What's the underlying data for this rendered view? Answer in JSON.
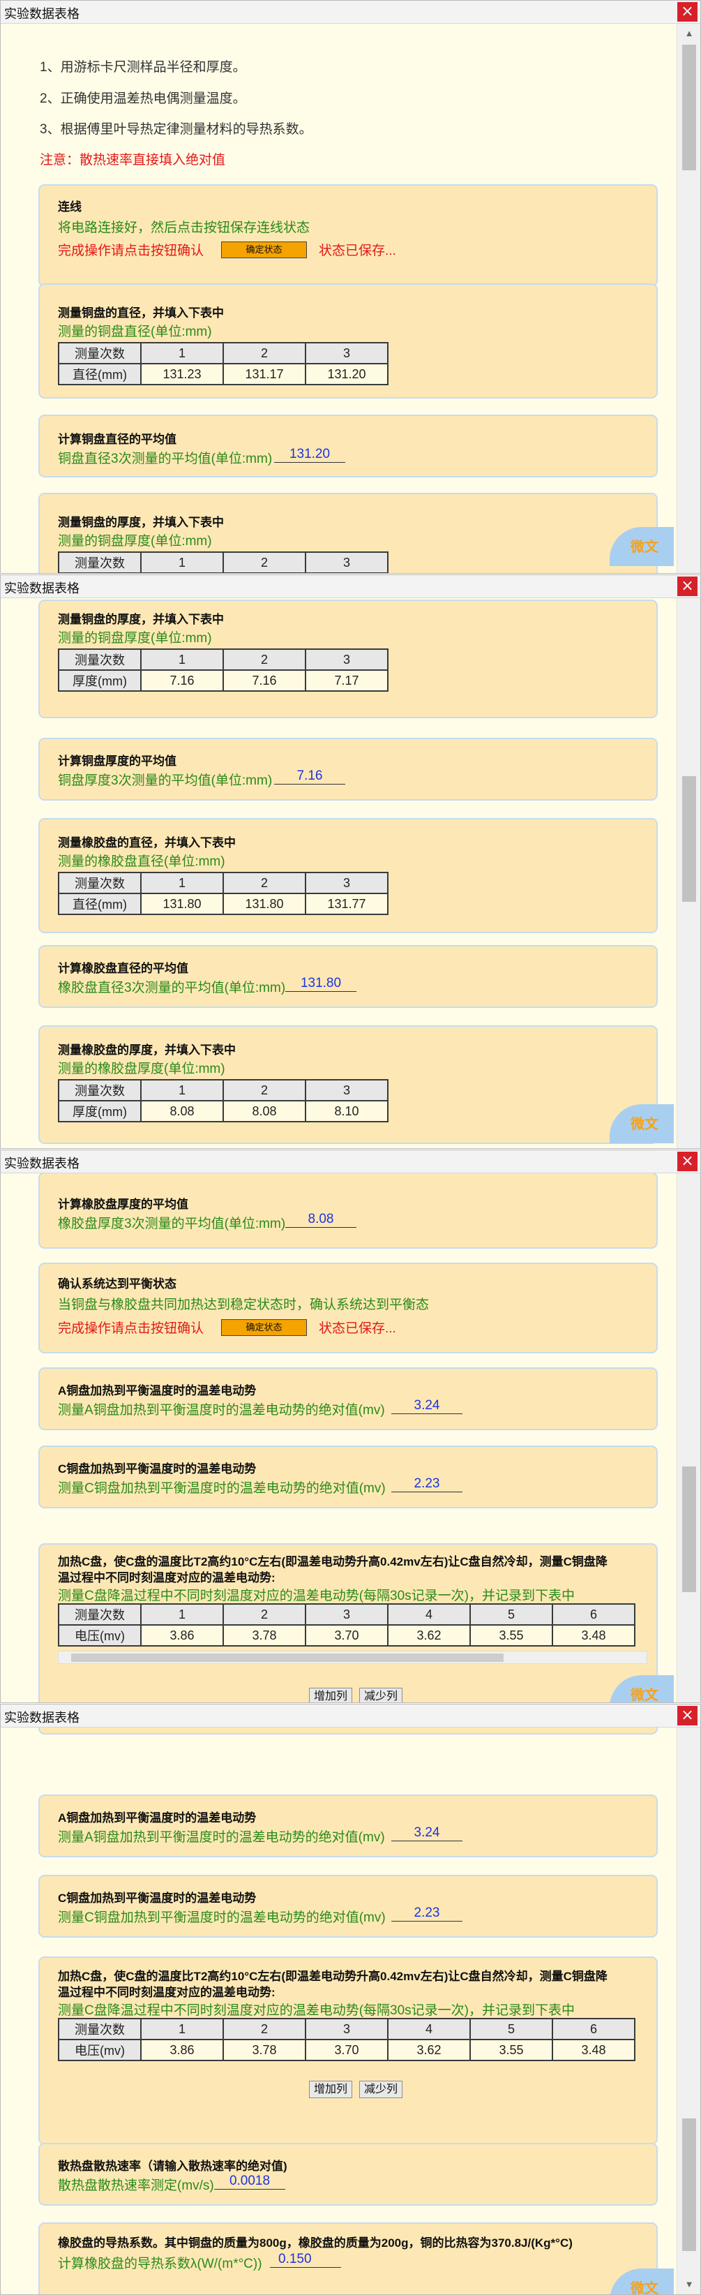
{
  "window_title": "实验数据表格",
  "close_glyph": "×",
  "instructions": [
    "1、用游标卡尺测样品半径和厚度。",
    "2、正确使用温差热电偶测量温度。",
    "3、根据傅里叶导热定律测量材料的导热系数。"
  ],
  "note": "注意：散热速率直接填入绝对值",
  "confirm_button": "确定状态",
  "saved_text": "状态已保存...",
  "chat_label": "微文",
  "add_col": "增加列",
  "del_col": "减少列",
  "connect": {
    "title": "连线",
    "line1": "将电路连接好，然后点击按钮保存连线状态",
    "prompt": "完成操作请点击按钮确认"
  },
  "count_label": "测量次数",
  "cols": [
    "1",
    "2",
    "3",
    "4",
    "5",
    "6"
  ],
  "cu_dia": {
    "title": "测量铜盘的直径，并填入下表中",
    "subtitle": "测量的铜盘直径(单位:mm)",
    "row_label": "直径(mm)",
    "values": [
      "131.23",
      "131.17",
      "131.20"
    ]
  },
  "cu_dia_avg": {
    "title": "计算铜盘直径的平均值",
    "label": "铜盘直径3次测量的平均值(单位:mm)",
    "value": "131.20"
  },
  "cu_thk": {
    "title": "测量铜盘的厚度，并填入下表中",
    "subtitle": "测量的铜盘厚度(单位:mm)",
    "row_label": "厚度(mm)",
    "values": [
      "7.16",
      "7.16",
      "7.17"
    ]
  },
  "cu_thk_avg": {
    "title": "计算铜盘厚度的平均值",
    "label": "铜盘厚度3次测量的平均值(单位:mm)",
    "value": "7.16"
  },
  "rb_dia": {
    "title": "测量橡胶盘的直径，并填入下表中",
    "subtitle": "测量的橡胶盘直径(单位:mm)",
    "row_label": "直径(mm)",
    "values": [
      "131.80",
      "131.80",
      "131.77"
    ]
  },
  "rb_dia_avg": {
    "title": "计算橡胶盘直径的平均值",
    "label": "橡胶盘直径3次测量的平均值(单位:mm)",
    "value": "131.80"
  },
  "rb_thk": {
    "title": "测量橡胶盘的厚度，并填入下表中",
    "subtitle": "测量的橡胶盘厚度(单位:mm)",
    "row_label": "厚度(mm)",
    "values": [
      "8.08",
      "8.08",
      "8.10"
    ]
  },
  "rb_thk_avg": {
    "title": "计算橡胶盘厚度的平均值",
    "label": "橡胶盘厚度3次测量的平均值(单位:mm)",
    "value": "8.08"
  },
  "balance": {
    "title": "确认系统达到平衡状态",
    "line1": "当铜盘与橡胶盘共同加热达到稳定状态时，确认系统达到平衡态",
    "prompt": "完成操作请点击按钮确认"
  },
  "a_emf": {
    "title": "A铜盘加热到平衡温度时的温差电动势",
    "label": "测量A铜盘加热到平衡温度时的温差电动势的绝对值(mv)",
    "value": "3.24"
  },
  "c_emf": {
    "title": "C铜盘加热到平衡温度时的温差电动势",
    "label": "测量C铜盘加热到平衡温度时的温差电动势的绝对值(mv)",
    "value": "2.23"
  },
  "cooling": {
    "title1": "加热C盘，使C盘的温度比T2高约10°C左右(即温差电动势升高0.42mv左右)让C盘自然冷却，测量C铜盘降",
    "title2": "温过程中不同时刻温度对应的温差电动势:",
    "subtitle": "测量C盘降温过程中不同时刻温度对应的温差电动势(每隔30s记录一次)，并记录到下表中",
    "row_label": "电压(mv)",
    "values": [
      "3.86",
      "3.78",
      "3.70",
      "3.62",
      "3.55",
      "3.48"
    ]
  },
  "rate": {
    "title": "散热盘散热速率（请输入散热速率的绝对值)",
    "label": "散热盘散热速率测定(mv/s)",
    "value": "0.0018"
  },
  "k": {
    "title": "橡胶盘的导热系数。其中铜盘的质量为800g，橡胶盘的质量为200g，铜的比热容为370.8J/(Kg*°C)",
    "label": "计算橡胶盘的导热系数λ(W/(m*°C))",
    "value": "0.150"
  }
}
